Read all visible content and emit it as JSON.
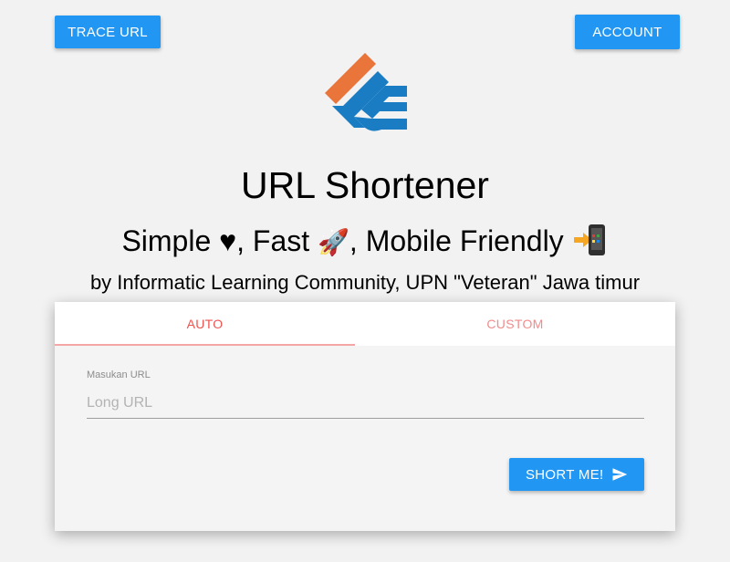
{
  "header": {
    "trace_url_label": "TRACE URL",
    "account_label": "ACCOUNT"
  },
  "hero": {
    "title": "URL Shortener",
    "subtitle_words": [
      "Simple",
      "Fast",
      "Mobile Friendly"
    ],
    "subtitle_icons": [
      "heart-icon",
      "rocket-icon",
      "mobile-arrow-icon"
    ],
    "byline": "by Informatic Learning Community, UPN \"Veteran\" Jawa timur"
  },
  "card": {
    "tabs": [
      {
        "label": "AUTO",
        "active": true
      },
      {
        "label": "CUSTOM",
        "active": false
      }
    ],
    "field_label": "Masukan URL",
    "field_placeholder": "Long URL",
    "field_value": "",
    "submit_label": "SHORT ME!"
  },
  "colors": {
    "primary_button": "#2196f3",
    "active_tab": "#ef5350",
    "logo_orange": "#e9753b",
    "logo_blue": "#1a7dc4"
  }
}
